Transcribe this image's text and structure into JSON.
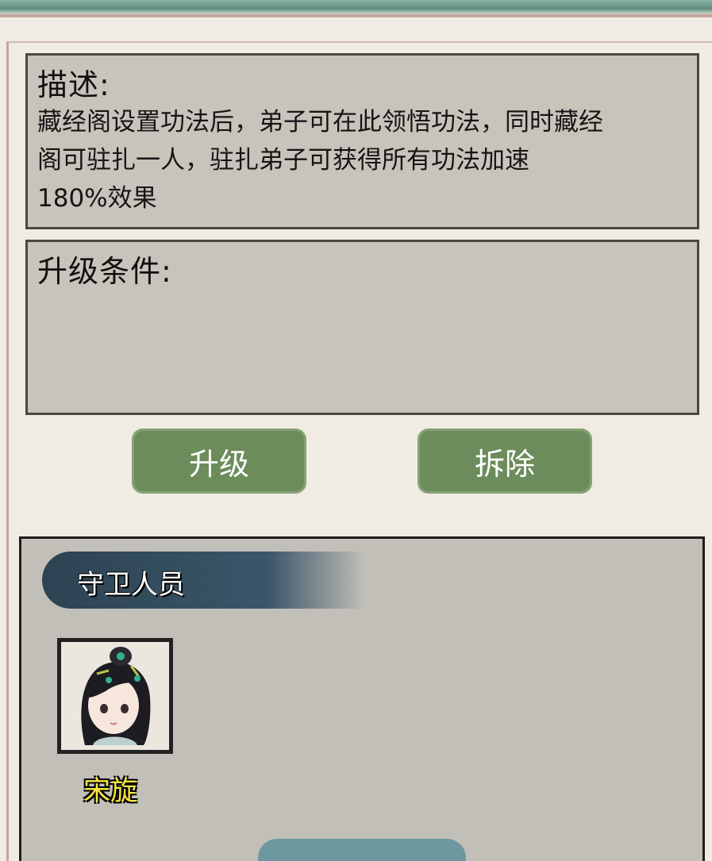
{
  "description": {
    "title": "描述:",
    "lines": [
      "藏经阁设置功法后，弟子可在此领悟功法，同时藏经",
      "阁可驻扎一人，驻扎弟子可获得所有功法加速",
      "180%效果"
    ]
  },
  "conditions": {
    "title": "升级条件:"
  },
  "buttons": {
    "upgrade": "升级",
    "demolish": "拆除"
  },
  "guard": {
    "title": "守卫人员",
    "members": [
      {
        "name": "宋旋"
      }
    ]
  },
  "colors": {
    "button_green": "#6c8c5b",
    "banner_blue": "#2c4352",
    "name_yellow": "#f7e641"
  }
}
